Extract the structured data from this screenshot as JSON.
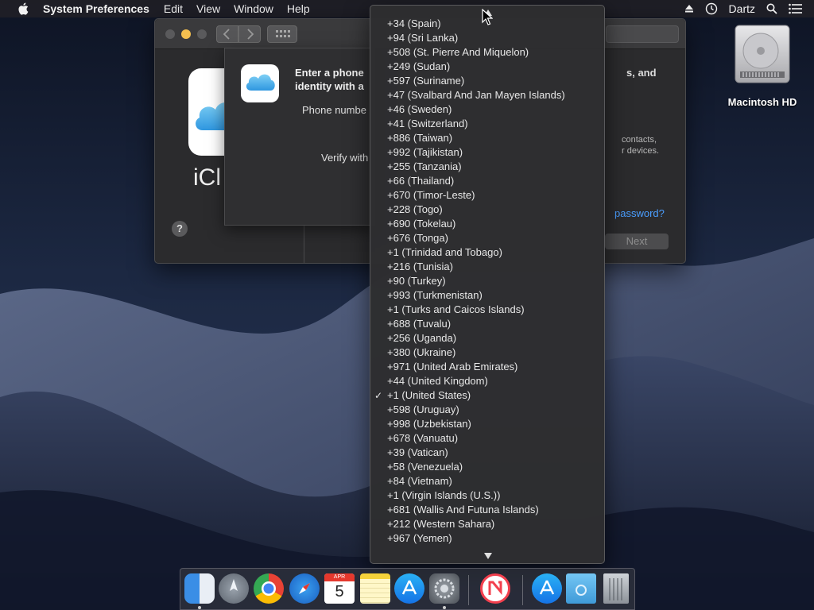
{
  "menubar": {
    "app_name": "System Preferences",
    "items": [
      "Edit",
      "View",
      "Window",
      "Help"
    ],
    "user": "Dartz",
    "icons": [
      "eject-icon",
      "time-machine-icon",
      "search-icon",
      "notification-list-icon"
    ]
  },
  "desktop": {
    "hd_label": "Macintosh HD"
  },
  "window": {
    "pane_title": "iCl",
    "right_bold": "s, and",
    "right_small_1": "contacts,",
    "right_small_2": "r devices.",
    "forgot_link": "password?",
    "next_label": "Next",
    "help_label": "?"
  },
  "sheet": {
    "title_line1": "Enter a phone",
    "title_line2": "identity with a",
    "phone_label": "Phone numbe",
    "verify_label": "Verify with"
  },
  "popup": {
    "items": [
      {
        "label": "+34 (Spain)",
        "checked": false
      },
      {
        "label": "+94 (Sri Lanka)",
        "checked": false
      },
      {
        "label": "+508 (St. Pierre And Miquelon)",
        "checked": false
      },
      {
        "label": "+249 (Sudan)",
        "checked": false
      },
      {
        "label": "+597 (Suriname)",
        "checked": false
      },
      {
        "label": "+47 (Svalbard And Jan Mayen Islands)",
        "checked": false
      },
      {
        "label": "+46 (Sweden)",
        "checked": false
      },
      {
        "label": "+41 (Switzerland)",
        "checked": false
      },
      {
        "label": "+886 (Taiwan)",
        "checked": false
      },
      {
        "label": "+992 (Tajikistan)",
        "checked": false
      },
      {
        "label": "+255 (Tanzania)",
        "checked": false
      },
      {
        "label": "+66 (Thailand)",
        "checked": false
      },
      {
        "label": "+670 (Timor-Leste)",
        "checked": false
      },
      {
        "label": "+228 (Togo)",
        "checked": false
      },
      {
        "label": "+690 (Tokelau)",
        "checked": false
      },
      {
        "label": "+676 (Tonga)",
        "checked": false
      },
      {
        "label": "+1 (Trinidad and Tobago)",
        "checked": false
      },
      {
        "label": "+216 (Tunisia)",
        "checked": false
      },
      {
        "label": "+90 (Turkey)",
        "checked": false
      },
      {
        "label": "+993 (Turkmenistan)",
        "checked": false
      },
      {
        "label": "+1 (Turks and Caicos Islands)",
        "checked": false
      },
      {
        "label": "+688 (Tuvalu)",
        "checked": false
      },
      {
        "label": "+256 (Uganda)",
        "checked": false
      },
      {
        "label": "+380 (Ukraine)",
        "checked": false
      },
      {
        "label": "+971 (United Arab Emirates)",
        "checked": false
      },
      {
        "label": "+44 (United Kingdom)",
        "checked": false
      },
      {
        "label": "+1 (United States)",
        "checked": true
      },
      {
        "label": "+598 (Uruguay)",
        "checked": false
      },
      {
        "label": "+998 (Uzbekistan)",
        "checked": false
      },
      {
        "label": "+678 (Vanuatu)",
        "checked": false
      },
      {
        "label": "+39 (Vatican)",
        "checked": false
      },
      {
        "label": "+58 (Venezuela)",
        "checked": false
      },
      {
        "label": "+84 (Vietnam)",
        "checked": false
      },
      {
        "label": "+1 (Virgin Islands (U.S.))",
        "checked": false
      },
      {
        "label": "+681 (Wallis And Futuna Islands)",
        "checked": false
      },
      {
        "label": "+212 (Western Sahara)",
        "checked": false
      },
      {
        "label": "+967 (Yemen)",
        "checked": false
      }
    ],
    "check_glyph": "✓"
  },
  "dock": {
    "calendar_month": "APR",
    "calendar_day": "5",
    "items": [
      "finder-icon",
      "launchpad-icon",
      "chrome-icon",
      "safari-icon",
      "calendar-icon",
      "notes-icon",
      "app-store-icon",
      "system-preferences-icon",
      "news-icon",
      "app-store-downloads-icon",
      "downloads-folder-icon",
      "trash-icon"
    ]
  },
  "colors": {
    "accent_link": "#4a9eff",
    "window_bg": "#2b2b2d",
    "menu_bg": "#2e2e30"
  }
}
